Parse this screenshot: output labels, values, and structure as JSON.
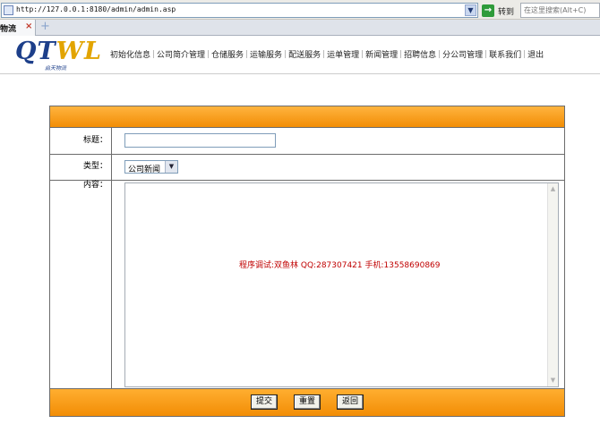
{
  "browser": {
    "url": "http://127.0.0.1:8180/admin/admin.asp",
    "go_label": "转到",
    "search_placeholder": "在这里搜索(Alt+C)",
    "tab_label": "物流",
    "tab_close": "×",
    "new_tab": "+"
  },
  "header": {
    "logo_main": "QT",
    "logo_accent": "WL",
    "logo_sub": "启天物流",
    "nav": [
      {
        "label": "初始化信息"
      },
      {
        "label": "公司简介管理"
      },
      {
        "label": "仓储服务"
      },
      {
        "label": "运输服务"
      },
      {
        "label": "配送服务"
      },
      {
        "label": "运单管理"
      },
      {
        "label": "新闻管理"
      },
      {
        "label": "招聘信息"
      },
      {
        "label": "分公司管理"
      },
      {
        "label": "联系我们"
      },
      {
        "label": "退出"
      }
    ]
  },
  "form": {
    "title_label": "标题：",
    "title_value": "",
    "type_label": "类型：",
    "type_value": "公司新闻",
    "content_label": "内容：",
    "content_note": "程序调试:双鱼林 QQ:287307421 手机:13558690869",
    "buttons": {
      "submit": "提交",
      "reset": "重置",
      "back": "返回"
    }
  },
  "colors": {
    "accent": "#f28d05",
    "nav_text": "#222222",
    "note_text": "#c00000",
    "logo_blue": "#1d3f8a"
  },
  "icons": {
    "address_page": "page-icon",
    "address_dropdown": "chevron-down-icon",
    "go": "go-arrow-icon",
    "tab_close": "close-icon",
    "new_tab": "plus-icon"
  }
}
